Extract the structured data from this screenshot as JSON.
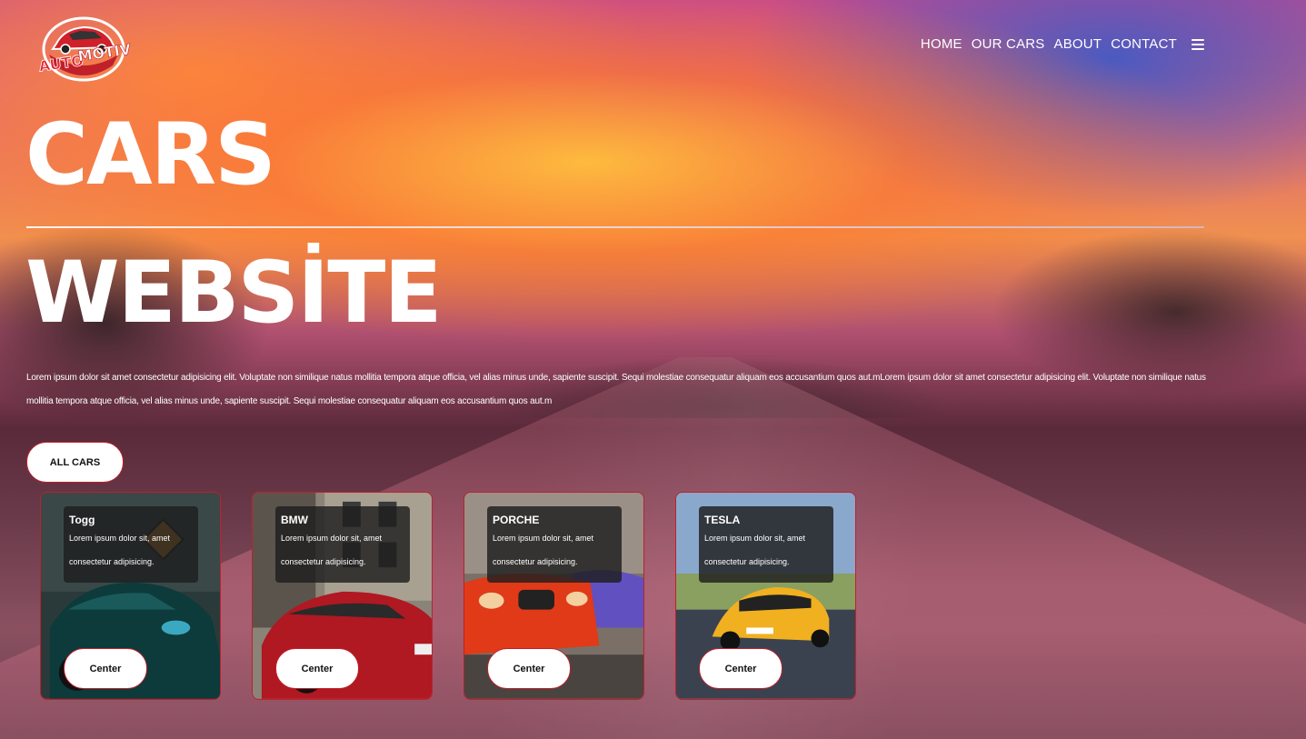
{
  "header": {
    "logo_text": "AUTOMOTIVE",
    "nav": [
      "HOME",
      "OUR CARS",
      "ABOUT",
      "CONTACT"
    ],
    "menu_icon": "hamburger-icon"
  },
  "hero": {
    "title_line1": "CARS",
    "title_line2": "WEBSİTE",
    "description": "Lorem ipsum dolor sit amet consectetur adipisicing elit. Voluptate non similique natus mollitia tempora atque officia, vel alias minus unde, sapiente suscipit. Sequi molestiae consequatur aliquam eos accusantium quos aut.mLorem ipsum dolor sit amet consectetur adipisicing elit. Voluptate non similique natus mollitia tempora atque officia, vel alias minus unde, sapiente suscipit. Sequi molestiae consequatur aliquam eos accusantium quos aut.m",
    "button": "ALL CARS"
  },
  "cards": [
    {
      "name": "Togg",
      "desc": "Lorem ipsum dolor sit, amet consectetur adipisicing.",
      "button": "Center",
      "car_color": "#0d3a3a",
      "bg": "#1c2a2a",
      "accent": "#d08a2a"
    },
    {
      "name": "BMW",
      "desc": "Lorem ipsum dolor sit, amet consectetur adipisicing.",
      "button": "Center",
      "car_color": "#b01822",
      "bg": "#8a8478",
      "accent": "#c9c2b4"
    },
    {
      "name": "PORCHE",
      "desc": "Lorem ipsum dolor sit, amet consectetur adipisicing.",
      "button": "Center",
      "car_color": "#e03a18",
      "bg": "#7a7068",
      "accent": "#6050c0"
    },
    {
      "name": "TESLA",
      "desc": "Lorem ipsum dolor sit, amet consectetur adipisicing.",
      "button": "Center",
      "car_color": "#f0b020",
      "bg": "#6a8ab0",
      "accent": "#8aa060"
    }
  ]
}
